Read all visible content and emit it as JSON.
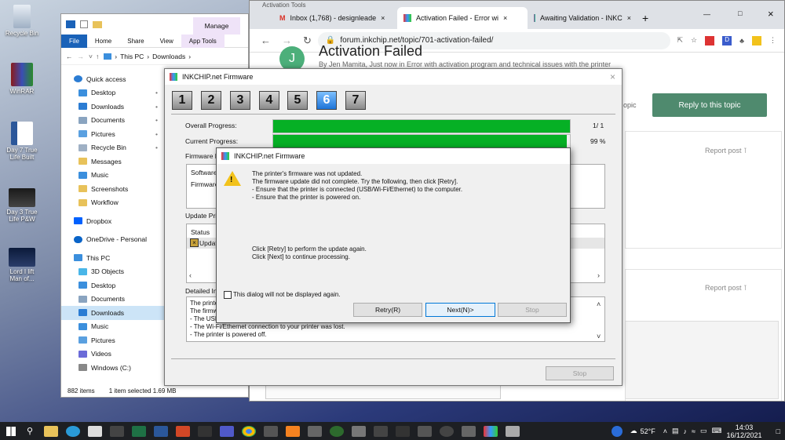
{
  "desktop": {
    "icons": [
      {
        "label": "Recycle Bin",
        "icon": "recycle-bin-icon"
      },
      {
        "label": "WinRAR",
        "icon": "winrar-icon"
      },
      {
        "label": "Day 7 True Life Built",
        "icon": "word-doc-icon"
      },
      {
        "label": "Day 3 True Life P&W",
        "icon": "video-icon"
      },
      {
        "label": "Lord I lift Man of...",
        "icon": "video-icon"
      }
    ]
  },
  "explorer": {
    "qa_tabs": [
      "File",
      "Home",
      "Share",
      "View",
      "App Tools"
    ],
    "manage_label": "Manage",
    "breadcrumb": [
      "This PC",
      "Downloads"
    ],
    "quick_access": "Quick access",
    "quick_items": [
      "Desktop",
      "Downloads",
      "Documents",
      "Pictures",
      "Recycle Bin",
      "Messages",
      "Music",
      "Screenshots",
      "Workflow"
    ],
    "dropbox": "Dropbox",
    "onedrive": "OneDrive - Personal",
    "thispc": "This PC",
    "pc_items": [
      "3D Objects",
      "Desktop",
      "Documents",
      "Downloads",
      "Music",
      "Pictures",
      "Videos",
      "Windows (C:)"
    ],
    "status_items": "882 items",
    "status_sel": "1 item selected  1.69 MB"
  },
  "chrome": {
    "tabs": [
      "Activation Tools",
      "Inbox (1,768) - designleade",
      "Activation Failed - Error wi",
      "Awaiting Validation - INKC"
    ],
    "url": "forum.inkchip.net/topic/701-activation-failed/",
    "page_title": "Activation Failed",
    "author_line": "By Jen Mamita, Just now in Error with activation program and technical issues with the printer",
    "avatar_letter": "J",
    "topic_fragment": "opic",
    "reply_button": "Reply to this topic",
    "report_post": "Report post",
    "report_post2": "Report post"
  },
  "installer": {
    "title": "INKCHIP.net Firmware",
    "steps": [
      "1",
      "2",
      "3",
      "4",
      "5",
      "6",
      "7"
    ],
    "current_step": "6",
    "overall_label": "Overall Progress:",
    "overall_value": "1/ 1",
    "overall_pct": 1.0,
    "current_label": "Current Progress:",
    "current_value": "99 %",
    "current_pct": 0.99,
    "firmware_label": "Firmware F",
    "software_label": "Software",
    "firmware_row": "Firmware",
    "update_label": "Update Print",
    "status_header": "Status",
    "update_row": "Update",
    "detailed_label": "Detailed Inf",
    "detail_lines": [
      "The printe",
      "The firmwa",
      "- The USB",
      "- The Wi-Fi/Ethernet connection to your printer was lost.",
      "- The printer is powered off."
    ],
    "stop_button": "Stop"
  },
  "dialog": {
    "title": "INKCHIP.net Firmware",
    "messages": [
      "The printer's firmware was not updated.",
      "The firmware update did not complete. Try the following, then click [Retry].",
      "- Ensure that the printer is connected (USB/Wi-Fi/Ethernet) to the computer.",
      "- Ensure that the printer is powered on."
    ],
    "retry_hint": "Click [Retry] to perform the update again.",
    "next_hint": "Click [Next] to continue processing.",
    "checkbox_label": "This dialog will not be displayed again.",
    "retry_button": "Retry(R)",
    "next_button": "Next(N)>",
    "stop_button": "Stop"
  },
  "taskbar": {
    "temp": "52°F",
    "time": "14:03",
    "date": "16/12/2021"
  }
}
